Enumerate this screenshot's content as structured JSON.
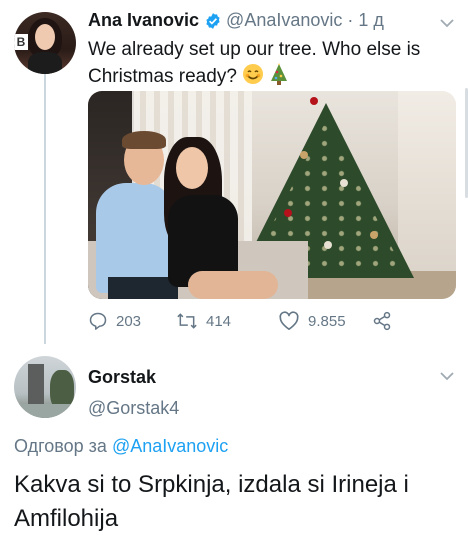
{
  "tweet1": {
    "author_name": "Ana Ivanovic",
    "handle": "@AnaIvanovic",
    "separator": "·",
    "time": "1 д",
    "text_line1": "We already set up our tree. Who else is",
    "text_line2": "Christmas ready?",
    "verified_icon": "verified-badge-icon",
    "avatar_badge": "B",
    "stats": {
      "replies": "203",
      "retweets": "414",
      "likes": "9.855"
    }
  },
  "tweet2": {
    "author_name": "Gorstak",
    "handle": "@Gorstak4",
    "reply_label": "Одговор за",
    "reply_mention": "@AnaIvanovic",
    "text": "Kakva si to Srpkinja, izdala si Irineja i Amfilohija"
  },
  "colors": {
    "link_blue": "#1da1f2",
    "secondary_text": "#657786",
    "primary_text": "#14171a",
    "thread_line": "#ccd6dd"
  }
}
